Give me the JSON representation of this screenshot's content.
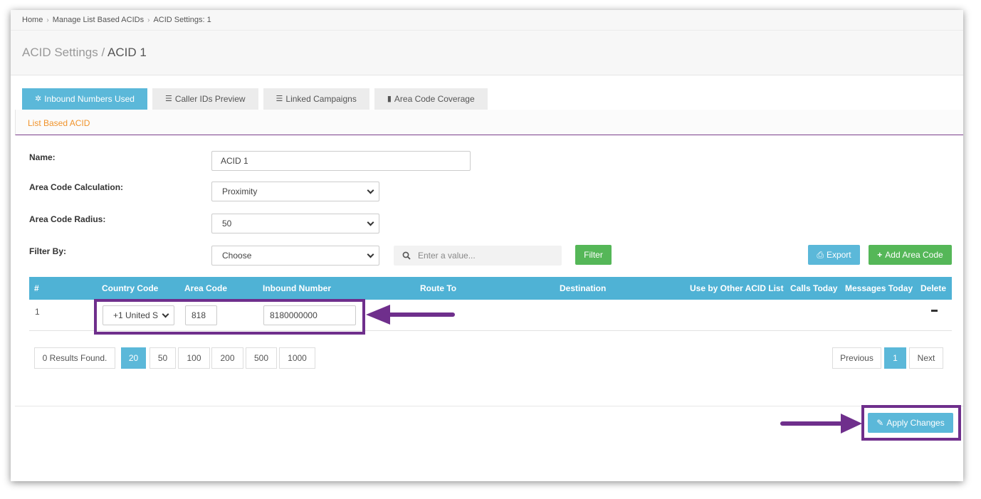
{
  "breadcrumb": [
    "Home",
    "Manage List Based ACIDs",
    "ACID Settings: 1"
  ],
  "page_title": {
    "prefix": "ACID Settings /",
    "name": "ACID 1"
  },
  "tabs": [
    {
      "label": "Inbound Numbers Used",
      "icon": "gear-icon",
      "glyph": "✲"
    },
    {
      "label": "Caller IDs Preview",
      "icon": "list-icon",
      "glyph": "☰"
    },
    {
      "label": "Linked Campaigns",
      "icon": "list-icon",
      "glyph": "☰"
    },
    {
      "label": "Area Code Coverage",
      "icon": "file-icon",
      "glyph": "▮"
    }
  ],
  "section_title": "List Based ACID",
  "form": {
    "name_label": "Name:",
    "name_value": "ACID 1",
    "calc_label": "Area Code Calculation:",
    "calc_value": "Proximity",
    "radius_label": "Area Code Radius:",
    "radius_value": "50",
    "filter_label": "Filter By:",
    "filter_value": "Choose",
    "search_placeholder": "Enter a value...",
    "filter_button": "Filter",
    "export_button": "Export",
    "add_button": "Add Area Code"
  },
  "table": {
    "headers": [
      "#",
      "Country Code",
      "Area Code",
      "Inbound Number",
      "Route To",
      "Destination",
      "Use by Other ACID List",
      "Calls Today",
      "Messages Today",
      "Delete"
    ],
    "rows": [
      {
        "index": "1",
        "country": "+1 United S",
        "area_code": "818",
        "inbound_number": "8180000000"
      }
    ]
  },
  "pagination": {
    "results": "0 Results Found.",
    "sizes": [
      "20",
      "50",
      "100",
      "200",
      "500",
      "1000"
    ],
    "active_size": "20",
    "previous": "Previous",
    "page": "1",
    "next": "Next"
  },
  "apply_button": "Apply Changes",
  "colors": {
    "accent": "#5bb8d9",
    "header": "#4fb2d5",
    "green": "#55b758",
    "highlight": "#6f2f8c",
    "orange": "#f0932b"
  }
}
